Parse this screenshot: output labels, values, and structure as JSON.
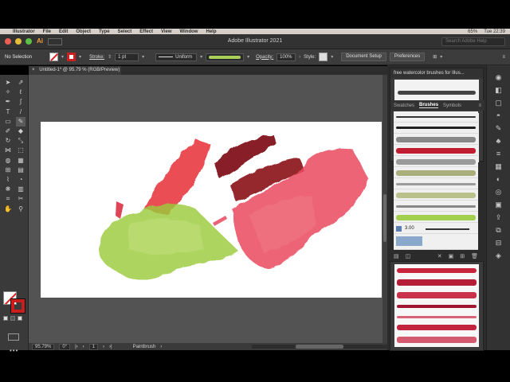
{
  "menubar": {
    "app": "Illustrator",
    "items": [
      "File",
      "Edit",
      "Object",
      "Type",
      "Select",
      "Effect",
      "View",
      "Window",
      "Help"
    ],
    "right": [
      "65%",
      "Tue 22:39"
    ]
  },
  "titlebar": {
    "title": "Adobe Illustrator 2021",
    "search_placeholder": "Search Adobe Help",
    "logo": "Ai"
  },
  "controlbar": {
    "selection": "No Selection",
    "stroke_label": "Stroke:",
    "stroke_value": "1 pt",
    "uniform_label": "Uniform",
    "opacity_label": "Opacity:",
    "opacity_value": "100%",
    "style_label": "Style:",
    "doc_setup": "Document Setup",
    "preferences": "Preferences"
  },
  "document": {
    "tab_title": "Untitled-1* @ 95.79 % (RGB/Preview)",
    "close": "×"
  },
  "statusbar": {
    "zoom": "95.79%",
    "rotation": "0°",
    "artboard": "1",
    "tool": "Paintbrush"
  },
  "panels": {
    "library_title": "free watercolor brushes for Illus...",
    "tabs": [
      "Swatches",
      "Brushes",
      "Symbols"
    ],
    "active_tab": "Brushes",
    "brush_size": "3.00"
  },
  "colors": {
    "accent_red": "#cc1f1f",
    "green": "#9acb3b",
    "dark_red": "#7e0e16",
    "pink": "#ea4b63"
  },
  "icons": {
    "tools": [
      "selection-tool-icon",
      "direct-selection-tool-icon",
      "magic-wand-icon",
      "lasso-icon",
      "pen-tool-icon",
      "curvature-tool-icon",
      "type-tool-icon",
      "line-tool-icon",
      "rectangle-tool-icon",
      "paintbrush-tool-icon",
      "shaper-tool-icon",
      "eraser-tool-icon",
      "rotate-tool-icon",
      "scale-tool-icon",
      "width-tool-icon",
      "free-transform-icon",
      "shape-builder-icon",
      "perspective-grid-icon",
      "mesh-tool-icon",
      "gradient-tool-icon",
      "eyedropper-icon",
      "blend-tool-icon",
      "symbol-sprayer-icon",
      "column-graph-icon",
      "artboard-tool-icon",
      "slice-tool-icon",
      "hand-tool-icon",
      "zoom-tool-icon"
    ]
  }
}
